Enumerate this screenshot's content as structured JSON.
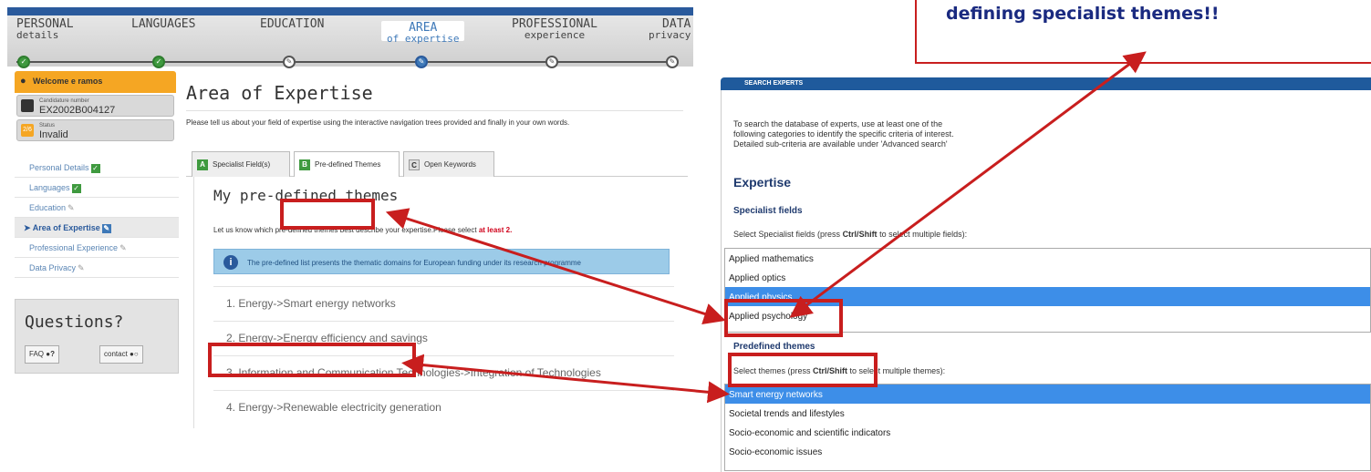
{
  "steps": [
    {
      "l1": "PERSONAL",
      "l2": "details"
    },
    {
      "l1": "LANGUAGES",
      "l2": ""
    },
    {
      "l1": "EDUCATION",
      "l2": ""
    },
    {
      "l1": "AREA",
      "l2": "of expertise"
    },
    {
      "l1": "PROFESSIONAL",
      "l2": "experience"
    },
    {
      "l1": "DATA",
      "l2": "privacy"
    }
  ],
  "sidebar": {
    "welcome": "Welcome e ramos",
    "candidature_label": "Candidature number",
    "candidature_value": "EX2002B004127",
    "status_badge": "2/6",
    "status_label": "Status",
    "status_value": "Invalid",
    "items": [
      {
        "label": "Personal Details"
      },
      {
        "label": "Languages"
      },
      {
        "label": "Education"
      },
      {
        "label": "Area of Expertise"
      },
      {
        "label": "Professional Experience"
      },
      {
        "label": "Data Privacy"
      }
    ],
    "questions": "Questions?",
    "faq": "FAQ",
    "contact": "contact"
  },
  "main": {
    "title": "Area of Expertise",
    "intro": "Please tell us about your field of expertise using the interactive navigation trees provided and finally in your own words.",
    "tabs": [
      {
        "letter": "A",
        "label": "Specialist Field(s)"
      },
      {
        "letter": "B",
        "label": "Pre-defined Themes"
      },
      {
        "letter": "C",
        "label": "Open Keywords"
      }
    ],
    "section_title": "My pre-defined themes",
    "letus_text": "Let us know which pre-defined themes best describe your expertise.Please select ",
    "letus_red": "at least 2.",
    "info": "The pre-defined list presents the thematic domains for European funding under its research programme",
    "themes": [
      "1. Energy->Smart energy networks",
      "2. Energy->Energy efficiency and savings",
      "3. Information and Communication Technologies->Integration of Technologies",
      "4. Energy->Renewable electricity generation"
    ]
  },
  "search": {
    "header": "SEARCH EXPERTS",
    "intro_lines": [
      "To search the database of experts, use at least one of the",
      "following categories to identify the specific criteria of interest.",
      "Detailed sub-criteria are available under 'Advanced search'"
    ],
    "expertise": "Expertise",
    "specialist_title": "Specialist fields",
    "specialist_hint_a": "Select Specialist fields (press ",
    "specialist_hint_b": "Ctrl/Shift",
    "specialist_hint_c": " to select multiple fields):",
    "specialist_options": [
      "Applied mathematics",
      "Applied optics",
      "Applied physics",
      "Applied psychology"
    ],
    "predefined_title": "Predefined themes",
    "predefined_hint_a": "Select themes (press ",
    "predefined_hint_b": "Ctrl/Shift",
    "predefined_hint_c": " to select multiple themes):",
    "predefined_options": [
      "Smart energy networks",
      "Societal trends and lifestyles",
      "Socio-economic and scientific indicators",
      "Socio-economic issues"
    ]
  },
  "callout": "defining specialist themes!!",
  "colors": {
    "accent": "#2a5a9c",
    "highlight": "#c81e1e",
    "selection": "#3d8ee8"
  }
}
